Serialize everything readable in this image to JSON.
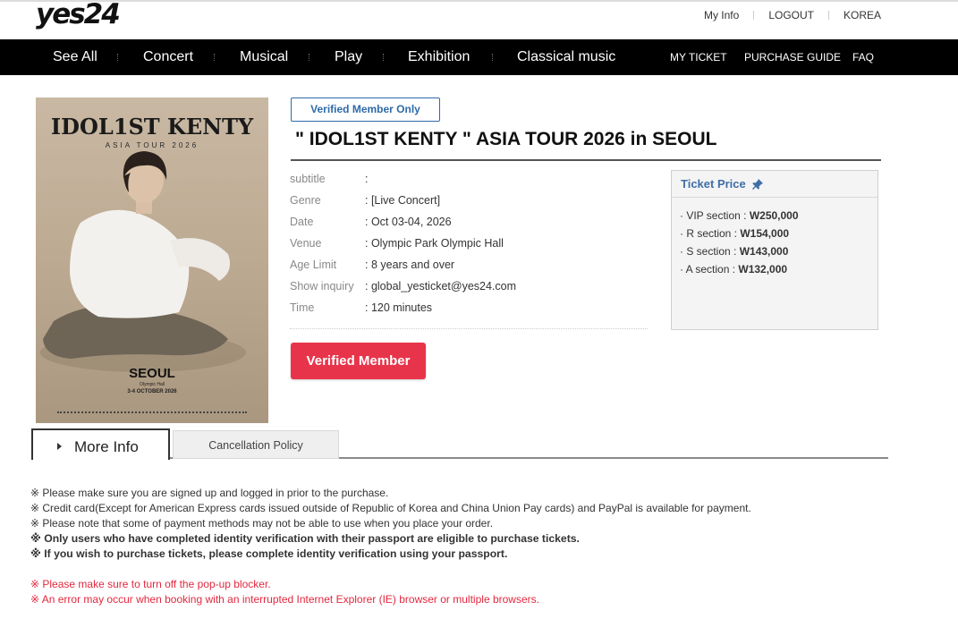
{
  "header": {
    "logo": "yes24",
    "util_links": [
      "My Info",
      "LOGOUT",
      "KOREA"
    ]
  },
  "nav": {
    "categories": [
      "See All",
      "Concert",
      "Musical",
      "Play",
      "Exhibition",
      "Classical music"
    ],
    "right_links": [
      "MY TICKET",
      "PURCHASE GUIDE",
      "FAQ"
    ]
  },
  "poster": {
    "title": "IDOL1ST KENTY",
    "subtitle": "ASIA TOUR 2026",
    "city": "SEOUL",
    "hall": "Olympic Hall",
    "dates": "3-4 OCTOBER 2026"
  },
  "event": {
    "badge": "Verified Member Only",
    "title": "\" IDOL1ST KENTY \"  ASIA TOUR 2026 in SEOUL",
    "details": [
      {
        "label": "subtitle",
        "value": ":"
      },
      {
        "label": "Genre",
        "value": ": [Live Concert]"
      },
      {
        "label": "Date",
        "value": ": Oct 03-04, 2026"
      },
      {
        "label": "Venue",
        "value": ": Olympic Park Olympic Hall"
      },
      {
        "label": "Age Limit",
        "value": ": 8 years and over"
      },
      {
        "label": "Show inquiry",
        "value": ": global_yesticket@yes24.com"
      },
      {
        "label": "Time",
        "value": ": 120 minutes"
      }
    ],
    "button_label": "Verified Member"
  },
  "ticket_price": {
    "heading": "Ticket Price",
    "rows": [
      {
        "label": "· VIP section : ",
        "price": "W250,000"
      },
      {
        "label": "· R section : ",
        "price": "W154,000"
      },
      {
        "label": "· S section : ",
        "price": "W143,000"
      },
      {
        "label": "· A section : ",
        "price": "W132,000"
      }
    ]
  },
  "tabs": {
    "active": "More Info",
    "inactive": "Cancellation Policy"
  },
  "notices": [
    "※ Please make sure you are signed up and logged in prior to the purchase.",
    "※ Credit card(Except for American Express cards issued outside of Republic of Korea and China Union Pay cards) and PayPal is available for payment.",
    "※ Please note that some of payment methods may not be able to use when you place your order.",
    "※ Only users who have completed identity verification with their passport are eligible to purchase tickets.",
    "※ If you wish to purchase tickets, please complete identity verification using your passport.",
    "※ Please make sure to turn off the pop-up blocker.",
    "※ An error may occur when booking with an interrupted Internet Explorer (IE) browser or multiple browsers."
  ],
  "colors": {
    "accent_red": "#e8344a",
    "link_blue": "#2e6aa8",
    "notice_red": "#e3283e"
  }
}
